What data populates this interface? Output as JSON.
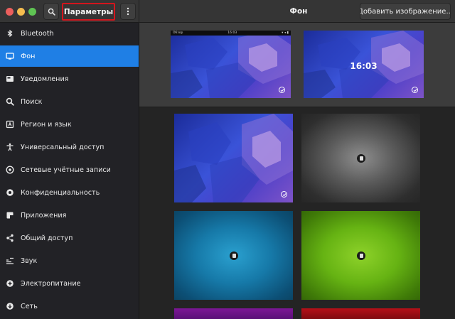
{
  "header": {
    "left_title": "Параметры",
    "center_title": "Фон",
    "add_button_label": "Добавить изображение..."
  },
  "sidebar": {
    "items": [
      {
        "label": "Bluetooth",
        "icon": "bluetooth-icon",
        "active": false
      },
      {
        "label": "Фон",
        "icon": "background-icon",
        "active": true
      },
      {
        "label": "Уведомления",
        "icon": "notifications-icon",
        "active": false
      },
      {
        "label": "Поиск",
        "icon": "search-icon",
        "active": false
      },
      {
        "label": "Регион и язык",
        "icon": "region-icon",
        "active": false
      },
      {
        "label": "Универсальный доступ",
        "icon": "accessibility-icon",
        "active": false
      },
      {
        "label": "Сетевые учётные записи",
        "icon": "online-accounts-icon",
        "active": false
      },
      {
        "label": "Конфиденциальность",
        "icon": "privacy-icon",
        "active": false
      },
      {
        "label": "Приложения",
        "icon": "applications-icon",
        "active": false
      },
      {
        "label": "Общий доступ",
        "icon": "sharing-icon",
        "active": false
      },
      {
        "label": "Звук",
        "icon": "sound-icon",
        "active": false
      },
      {
        "label": "Электропитание",
        "icon": "power-icon",
        "active": false
      },
      {
        "label": "Сеть",
        "icon": "network-icon",
        "active": false
      }
    ]
  },
  "preview": {
    "desktop_topbar_left": "Обзор",
    "desktop_topbar_center": "16:03",
    "lock_clock": "16:03"
  },
  "colors": {
    "accent": "#1f7fe5",
    "highlight_border": "#d4151d"
  }
}
